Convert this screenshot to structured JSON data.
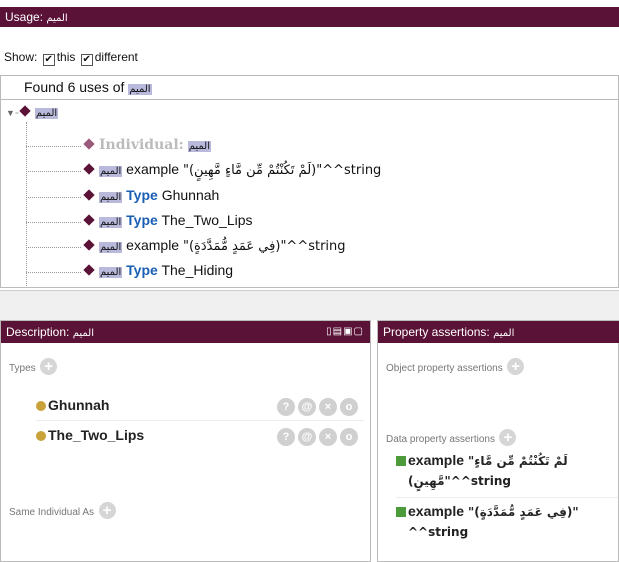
{
  "usage": {
    "title_prefix": "Usage:",
    "entity": "الميم",
    "show_label": "Show:",
    "opt_this": "this",
    "opt_different": "different",
    "found_text": "Found 6 uses of",
    "root": "الميم",
    "rows": [
      {
        "kind": "individual",
        "entity": "الميم",
        "prefix": "Individual:",
        "text": ""
      },
      {
        "kind": "example",
        "entity": "الميم",
        "prefix": "example",
        "text": "\"(لَمْ تَكُنْتُمْ مِّن مَّاءٍ مَّهِينٍ)\"^^string"
      },
      {
        "kind": "type",
        "entity": "الميم",
        "prefix": "Type",
        "text": "Ghunnah"
      },
      {
        "kind": "type",
        "entity": "الميم",
        "prefix": "Type",
        "text": "The_Two_Lips"
      },
      {
        "kind": "example",
        "entity": "الميم",
        "prefix": "example",
        "text": "\"(فِي عَمَدٍ مُّمَدَّدَةٍ)\"^^string"
      },
      {
        "kind": "type",
        "entity": "الميم",
        "prefix": "Type",
        "text": "The_Hiding"
      }
    ]
  },
  "description": {
    "title_prefix": "Description:",
    "entity": "الميم",
    "types_label": "Types",
    "types": [
      "Ghunnah",
      "The_Two_Lips"
    ],
    "same_individual_label": "Same Individual As",
    "controls": [
      "?",
      "@",
      "×",
      "o"
    ]
  },
  "property": {
    "title_prefix": "Property assertions:",
    "entity": "الميم",
    "object_label": "Object property assertions",
    "data_label": "Data property assertions",
    "assertions": [
      {
        "prop": "example",
        "value_line1": "\"لَمْ تَكُنْتُمْ مِّن مَّاءٍ",
        "value_line2": "(مَّهِينٍ\"^^string"
      },
      {
        "prop": "example",
        "value_line1": "\"(فِي عَمَدٍ مُّمَدَّدَةٍ)\"",
        "value_line2": "^^string"
      }
    ]
  },
  "colors": {
    "header": "#5a1237",
    "highlight": "#b9b9dc",
    "keyword": "#1a5fb4",
    "type_dot": "#c9a23b",
    "data_square": "#4c9a3a"
  },
  "icons": {
    "individual": "diamond-icon",
    "type": "circle-icon",
    "data_property": "square-icon",
    "add": "plus-icon"
  }
}
